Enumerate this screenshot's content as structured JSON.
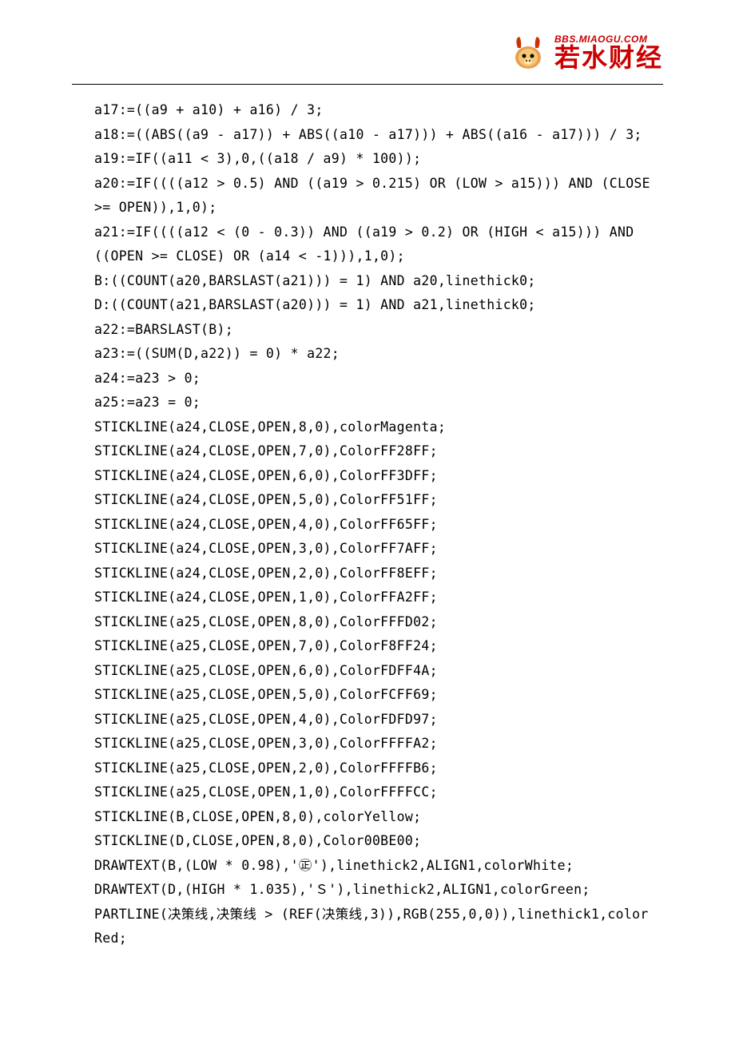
{
  "brand": {
    "url": "BBS.MIAOGU.COM",
    "name": "若水财经"
  },
  "code": {
    "lines": [
      "a17:=((a9 + a10) + a16) / 3;",
      "a18:=((ABS((a9 - a17)) + ABS((a10 - a17))) + ABS((a16 - a17))) / 3;",
      "a19:=IF((a11 < 3),0,((a18 / a9) * 100));",
      "a20:=IF((((a12 > 0.5) AND ((a19 > 0.215) OR (LOW > a15))) AND (CLOSE >= OPEN)),1,0);",
      "a21:=IF((((a12 < (0 - 0.3)) AND ((a19 > 0.2) OR (HIGH < a15))) AND ((OPEN >= CLOSE) OR (a14 < -1))),1,0);",
      "B:((COUNT(a20,BARSLAST(a21))) = 1) AND a20,linethick0;",
      "D:((COUNT(a21,BARSLAST(a20))) = 1) AND a21,linethick0;",
      "a22:=BARSLAST(B);",
      "a23:=((SUM(D,a22)) = 0) * a22;",
      "a24:=a23 > 0;",
      "a25:=a23 = 0;",
      "STICKLINE(a24,CLOSE,OPEN,8,0),colorMagenta;",
      "STICKLINE(a24,CLOSE,OPEN,7,0),ColorFF28FF;",
      "STICKLINE(a24,CLOSE,OPEN,6,0),ColorFF3DFF;",
      "STICKLINE(a24,CLOSE,OPEN,5,0),ColorFF51FF;",
      "STICKLINE(a24,CLOSE,OPEN,4,0),ColorFF65FF;",
      "STICKLINE(a24,CLOSE,OPEN,3,0),ColorFF7AFF;",
      "STICKLINE(a24,CLOSE,OPEN,2,0),ColorFF8EFF;",
      "STICKLINE(a24,CLOSE,OPEN,1,0),ColorFFA2FF;",
      "STICKLINE(a25,CLOSE,OPEN,8,0),ColorFFFD02;",
      "STICKLINE(a25,CLOSE,OPEN,7,0),ColorF8FF24;",
      "STICKLINE(a25,CLOSE,OPEN,6,0),ColorFDFF4A;",
      "STICKLINE(a25,CLOSE,OPEN,5,0),ColorFCFF69;",
      "STICKLINE(a25,CLOSE,OPEN,4,0),ColorFDFD97;",
      "STICKLINE(a25,CLOSE,OPEN,3,0),ColorFFFFA2;",
      "STICKLINE(a25,CLOSE,OPEN,2,0),ColorFFFFB6;",
      "STICKLINE(a25,CLOSE,OPEN,1,0),ColorFFFFCC;",
      "STICKLINE(B,CLOSE,OPEN,8,0),colorYellow;",
      "STICKLINE(D,CLOSE,OPEN,8,0),Color00BE00;",
      "DRAWTEXT(B,(LOW * 0.98),'㊣'),linethick2,ALIGN1,colorWhite;",
      "DRAWTEXT(D,(HIGH * 1.035),'Ｓ'),linethick2,ALIGN1,colorGreen;",
      "PARTLINE(决策线,决策线 > (REF(决策线,3)),RGB(255,0,0)),linethick1,colorRed;"
    ]
  }
}
